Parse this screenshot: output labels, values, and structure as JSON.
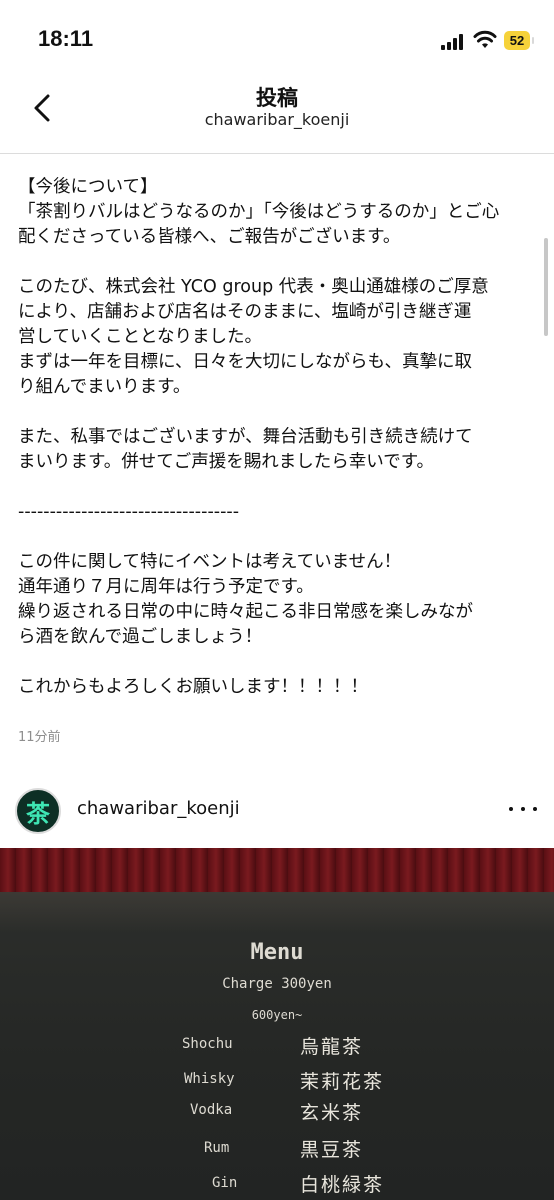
{
  "status_bar": {
    "time": "18:11",
    "battery": "52"
  },
  "header": {
    "title": "投稿",
    "username": "chawaribar_koenji"
  },
  "caption": {
    "paragraphs": [
      "【今後について】\n「茶割りバルはどうなるのか」「今後はどうするのか」とご心\n配くださっている皆様へ、ご報告がございます。",
      "このたび、株式会社 YCO group 代表・奥山通雄様のご厚意\nにより、店舗および店名はそのままに、塩崎が引き継ぎ運\n営していくこととなりました。\nまずは一年を目標に、日々を大切にしながらも、真摯に取\nり組んでまいります。",
      "また、私事ではございますが、舞台活動も引き続き続けて\nまいります。併せてご声援を賜れましたら幸いです。",
      "-----------------------------------",
      "この件に関して特にイベントは考えていません！\n通年通り７月に周年は行う予定です。\n繰り返される日常の中に時々起こる非日常感を楽しみなが\nら酒を飲んで過ごしましょう！",
      "これからもよろしくお願いします！！！！！"
    ],
    "time_ago": "11分前"
  },
  "post": {
    "username": "chawaribar_koenji",
    "avatar_glyph": "茶"
  },
  "menu_board": {
    "title": "Menu",
    "charge": "Charge 300yen",
    "price": "600yen~",
    "items": [
      {
        "spirit": "Shochu",
        "tea": "烏龍茶"
      },
      {
        "spirit": "Whisky",
        "tea": "茉莉花茶"
      },
      {
        "spirit": "Vodka",
        "tea": "玄米茶"
      },
      {
        "spirit": "Rum",
        "tea": "黒豆茶"
      },
      {
        "spirit": "Gin",
        "tea": "白桃緑茶"
      }
    ]
  },
  "colors": {
    "battery": "#f6d23a",
    "avatar_bg": "#0d2f25",
    "avatar_glyph": "#3ee6b4",
    "curtain": "#6a1419"
  }
}
